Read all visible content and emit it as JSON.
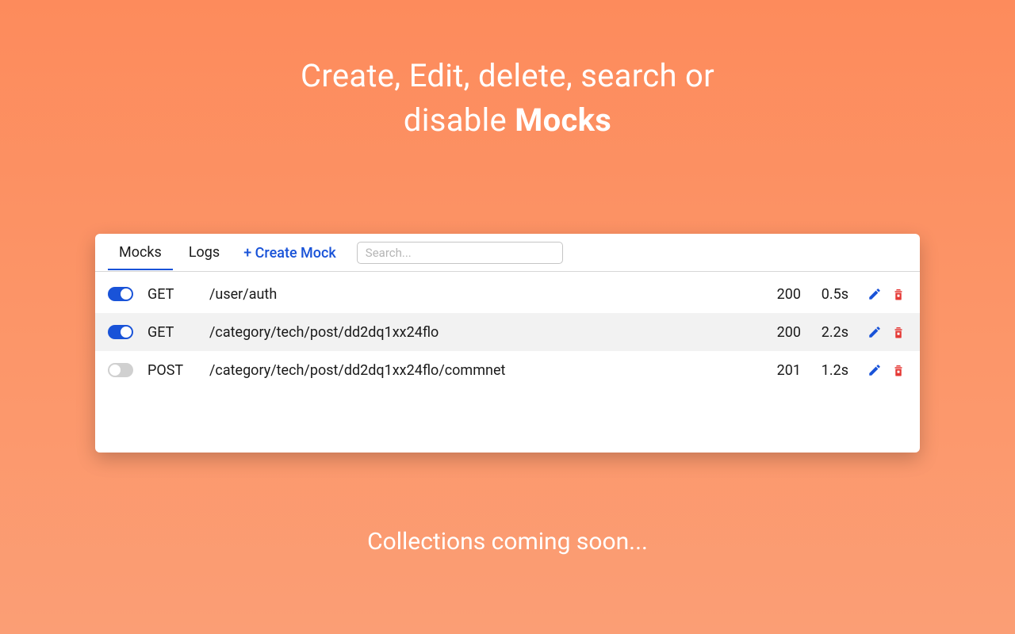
{
  "header": {
    "line1": "Create, Edit, delete, search or",
    "line2_prefix": "disable ",
    "line2_bold": "Mocks"
  },
  "tabs": {
    "mocks": "Mocks",
    "logs": "Logs",
    "create": "+ Create Mock"
  },
  "search": {
    "placeholder": "Search..."
  },
  "rows": [
    {
      "enabled": true,
      "method": "GET",
      "path": "/user/auth",
      "status": "200",
      "delay": "0.5s"
    },
    {
      "enabled": true,
      "method": "GET",
      "path": "/category/tech/post/dd2dq1xx24flo",
      "status": "200",
      "delay": "2.2s"
    },
    {
      "enabled": false,
      "method": "POST",
      "path": "/category/tech/post/dd2dq1xx24flo/commnet",
      "status": "201",
      "delay": "1.2s"
    }
  ],
  "footer": "Collections coming soon..."
}
